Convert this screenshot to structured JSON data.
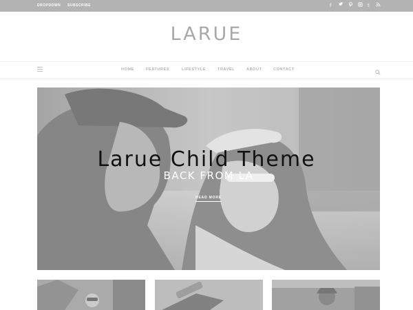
{
  "topbar": {
    "links": [
      "DROPDOWN",
      "SUBSCRIBE"
    ],
    "social_icons": [
      "facebook-icon",
      "twitter-icon",
      "pinterest-icon",
      "instagram-icon",
      "tumblr-icon",
      "rss-icon"
    ]
  },
  "site": {
    "logo": "LARUE"
  },
  "nav": {
    "items": [
      "HOME",
      "FEATURES",
      "LIFESTYLE",
      "TRAVEL",
      "ABOUT",
      "CONTACT"
    ]
  },
  "hero": {
    "subtitle": "BACK FROM LA",
    "read_more": "READ MORE"
  },
  "overlay": {
    "title": "Larue Child Theme"
  },
  "colors": {
    "topbar": "#b3b3b3",
    "logo": "#a8a8a8",
    "nav_text": "#b0b0b0",
    "overlay_text": "#111111"
  }
}
